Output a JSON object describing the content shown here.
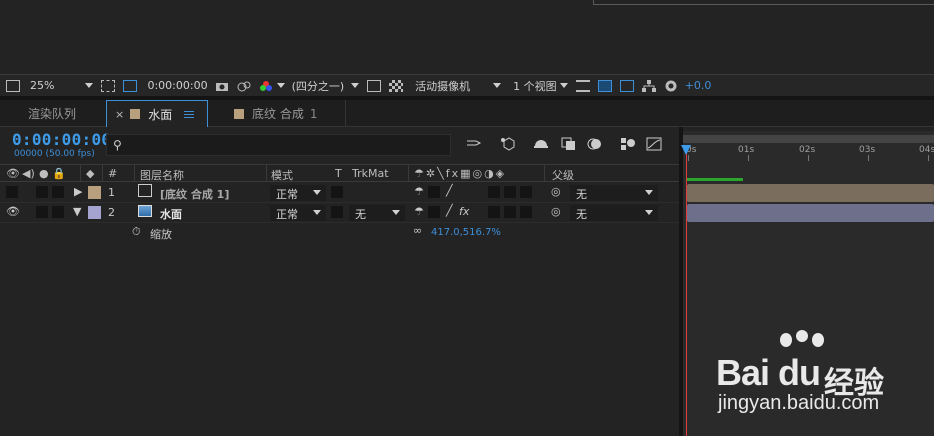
{
  "viewer_toolbar": {
    "zoom": "25%",
    "timecode": "0:00:00:00",
    "resolution": "(四分之一)",
    "camera": "活动摄像机",
    "views": "1 个视图",
    "exposure": "+0.0"
  },
  "tabs": [
    {
      "label": "渲染队列"
    },
    {
      "label": "水面",
      "close": "×"
    },
    {
      "label": "底纹 合成",
      "num": "1"
    }
  ],
  "timecode": {
    "value": "0:00:00:00",
    "fps": "00000 (50.00 fps)"
  },
  "ruler": {
    "labels": [
      "0s",
      "01s",
      "02s",
      "03s",
      "04s"
    ]
  },
  "columns": {
    "num": "#",
    "name": "图层名称",
    "mode": "模式",
    "t": "T",
    "trkmat": "TrkMat",
    "parent": "父级"
  },
  "layers": [
    {
      "index": "1",
      "name": "[底纹 合成 1]",
      "mode": "正常",
      "trkmat": "",
      "parent": "无",
      "label_color": "#b89f7e"
    },
    {
      "index": "2",
      "name": "水面",
      "mode": "正常",
      "trkmat": "无",
      "parent": "无",
      "label_color": "#a5a4d1"
    }
  ],
  "property": {
    "name": "缩放",
    "value": "417.0,516.7%"
  },
  "colors": {
    "accent": "#3d9be9",
    "cti": "#e23b3b",
    "workbar": "#2ca52c"
  },
  "watermark": {
    "logo": "Bai du",
    "cn": "经验",
    "url": "jingyan.baidu.com"
  }
}
